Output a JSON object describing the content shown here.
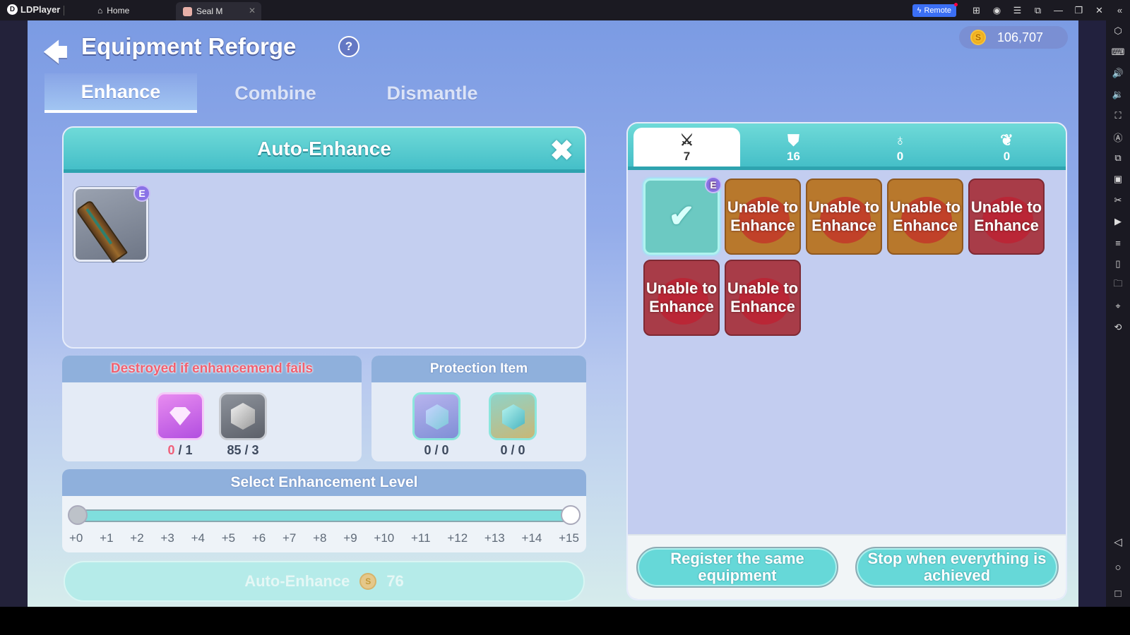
{
  "titlebar": {
    "app_name": "LDPlayer",
    "home_label": "Home",
    "tab_label": "Seal M",
    "remote_label": "Remote",
    "icons": [
      "gamepad-icon",
      "account-icon",
      "menu-icon",
      "window-icon",
      "minimize-icon",
      "restore-icon",
      "close-icon",
      "collapse-icon"
    ]
  },
  "sidebar": {
    "icons": [
      "settings-icon",
      "keyboard-icon",
      "volume-up-icon",
      "volume-down-icon",
      "screenshot-icon",
      "auto-rotate-icon",
      "multi-instance-icon",
      "apk-icon",
      "scissors-icon",
      "record-icon",
      "operation-icon",
      "shake-icon",
      "folder-icon",
      "location-icon",
      "rotate-icon"
    ],
    "nav_icons": [
      "back-icon",
      "home-icon",
      "recents-icon"
    ]
  },
  "header": {
    "title": "Equipment Reforge",
    "help_label": "?",
    "currency": "106,707"
  },
  "tabs": [
    {
      "label": "Enhance",
      "active": true
    },
    {
      "label": "Combine",
      "active": false
    },
    {
      "label": "Dismantle",
      "active": false
    }
  ],
  "auto_enhance_panel": {
    "title": "Auto-Enhance",
    "selected_item_badge": "E"
  },
  "destroy_box": {
    "title": "Destroyed if enhancemend fails",
    "materials": [
      {
        "name": "pink-gem",
        "have": "0",
        "need": "1"
      },
      {
        "name": "silver-stone",
        "have": "85",
        "need": "3"
      }
    ]
  },
  "protection_box": {
    "title": "Protection Item",
    "items": [
      {
        "name": "protection-scroll-purple",
        "count": "0 / 0"
      },
      {
        "name": "protection-scroll-teal",
        "count": "0 / 0"
      }
    ]
  },
  "enhancement_level": {
    "title": "Select Enhancement Level",
    "range_min": 0,
    "range_max": 15,
    "ticks": [
      "+0",
      "+1",
      "+2",
      "+3",
      "+4",
      "+5",
      "+6",
      "+7",
      "+8",
      "+9",
      "+10",
      "+11",
      "+12",
      "+13",
      "+14",
      "+15"
    ]
  },
  "auto_enhance_button": {
    "label": "Auto-Enhance",
    "cost": "76"
  },
  "categories": [
    {
      "icon": "weapon-icon",
      "count": "7",
      "active": true
    },
    {
      "icon": "armor-icon",
      "count": "16",
      "active": false
    },
    {
      "icon": "necklace-icon",
      "count": "0",
      "active": false
    },
    {
      "icon": "wing-icon",
      "count": "0",
      "active": false
    }
  ],
  "inventory": [
    {
      "state": "selected",
      "badge": "E",
      "label": ""
    },
    {
      "state": "orange",
      "label": "Unable to Enhance"
    },
    {
      "state": "orange",
      "label": "Unable to Enhance"
    },
    {
      "state": "orange",
      "label": "Unable to Enhance"
    },
    {
      "state": "red",
      "label": "Unable to Enhance"
    },
    {
      "state": "red",
      "label": "Unable to Enhance"
    },
    {
      "state": "red",
      "label": "Unable to Enhance"
    }
  ],
  "buttons": {
    "register_same": "Register the same equipment",
    "stop_when_achieved": "Stop when everything is achieved"
  }
}
